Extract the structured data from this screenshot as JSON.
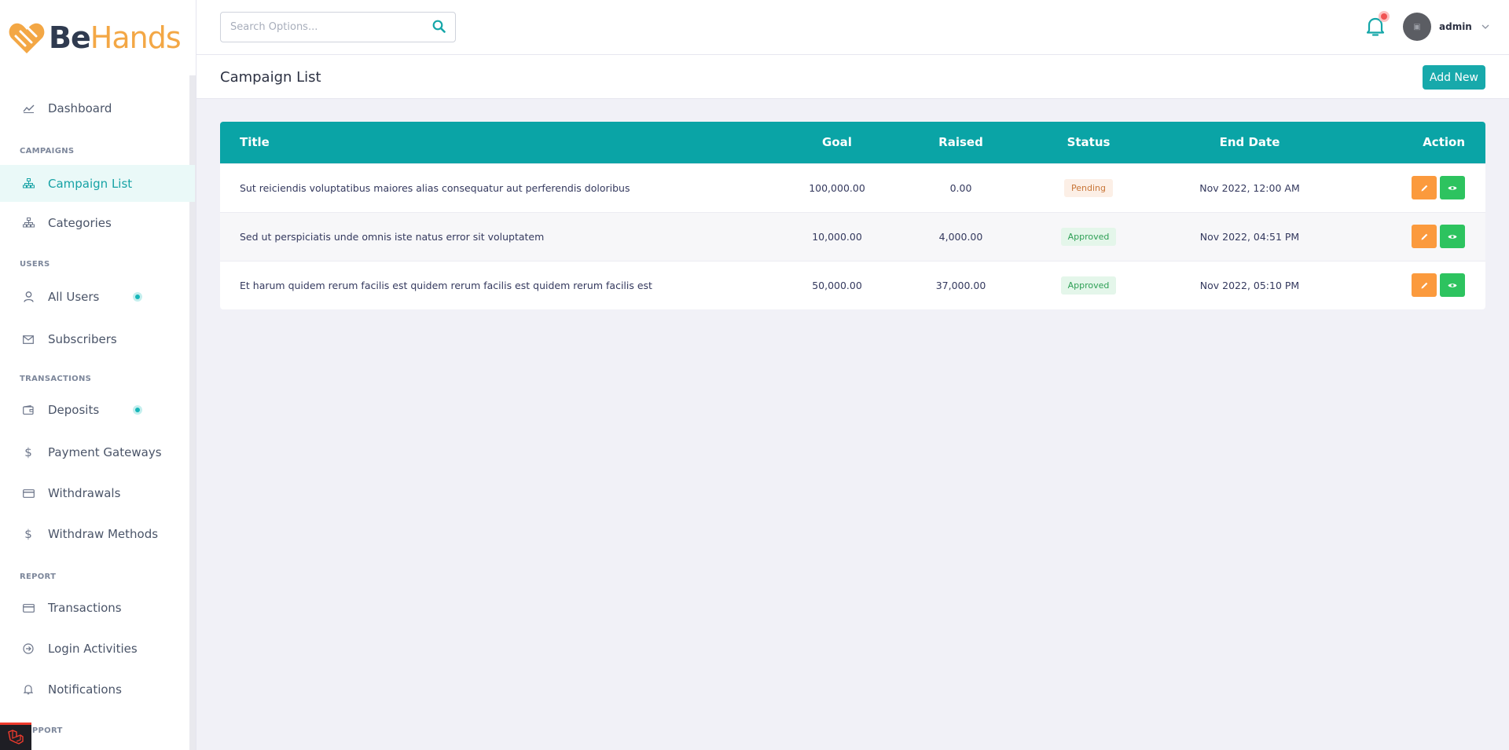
{
  "brand": {
    "name_be": "Be",
    "name_hands": "Hands"
  },
  "sidebar": {
    "dashboard": "Dashboard",
    "sections": {
      "campaigns": "CAMPAIGNS",
      "users": "USERS",
      "transactions": "TRANSACTIONS",
      "report": "REPORT",
      "support": "SUPPORT"
    },
    "items": {
      "campaign_list": "Campaign List",
      "categories": "Categories",
      "all_users": "All Users",
      "subscribers": "Subscribers",
      "deposits": "Deposits",
      "payment_gateways": "Payment Gateways",
      "withdrawals": "Withdrawals",
      "withdraw_methods": "Withdraw Methods",
      "transactions": "Transactions",
      "login_activities": "Login Activities",
      "notifications": "Notifications"
    }
  },
  "header": {
    "search_placeholder": "Search Options...",
    "user_name": "admin"
  },
  "page": {
    "title": "Campaign List",
    "add_button": "Add New"
  },
  "table": {
    "headers": {
      "title": "Title",
      "goal": "Goal",
      "raised": "Raised",
      "status": "Status",
      "end_date": "End Date",
      "action": "Action"
    },
    "rows": [
      {
        "title": "Sut reiciendis voluptatibus maiores alias consequatur aut perferendis doloribus",
        "goal": "100,000.00",
        "raised": "0.00",
        "status": "Pending",
        "end_date": "Nov 2022, 12:00 AM"
      },
      {
        "title": "Sed ut perspiciatis unde omnis iste natus error sit voluptatem",
        "goal": "10,000.00",
        "raised": "4,000.00",
        "status": "Approved",
        "end_date": "Nov 2022, 04:51 PM"
      },
      {
        "title": "Et harum quidem rerum facilis est quidem rerum facilis est quidem rerum facilis est",
        "goal": "50,000.00",
        "raised": "37,000.00",
        "status": "Approved",
        "end_date": "Nov 2022, 05:10 PM"
      }
    ]
  },
  "colors": {
    "accent": "#0aa4a6",
    "pending": "#c87638",
    "approved": "#2e9f55",
    "edit": "#fb9a3d",
    "view": "#2dc35f"
  }
}
